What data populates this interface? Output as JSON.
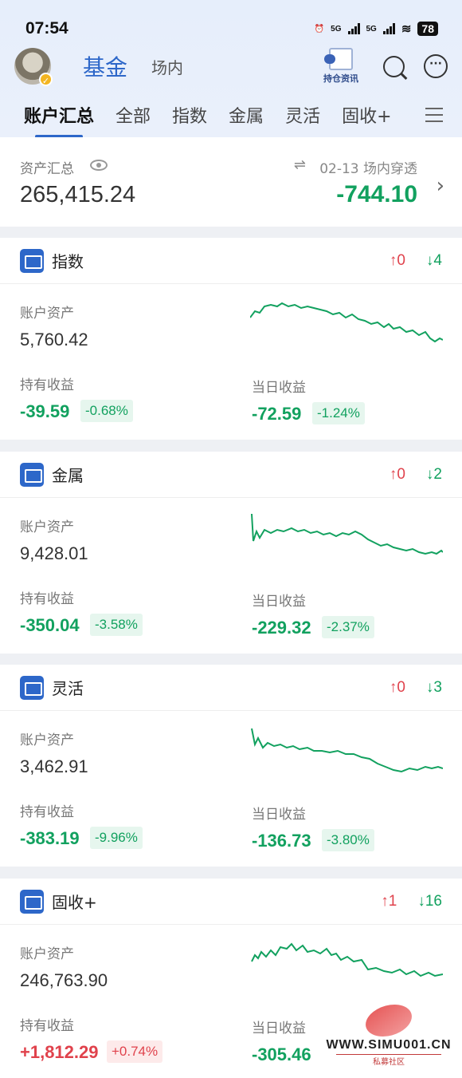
{
  "status_bar": {
    "time": "07:54",
    "net1": "5G",
    "net2": "5G",
    "battery": "78"
  },
  "header": {
    "title": "基金",
    "subtitle": "场内",
    "hold_news": "持仓资讯"
  },
  "tabs": [
    "账户汇总",
    "全部",
    "指数",
    "金属",
    "灵活",
    "固收+"
  ],
  "summary": {
    "label": "资产汇总",
    "value": "265,415.24",
    "date_label": "02-13 场内穿透",
    "change": "-744.10"
  },
  "labels": {
    "assets": "账户资产",
    "holding_pnl": "持有收益",
    "daily_pnl": "当日收益"
  },
  "cards": [
    {
      "title": "指数",
      "up": "↑0",
      "down": "↓4",
      "assets": "5,760.42",
      "holding_pnl": "-39.59",
      "holding_pct": "-0.68%",
      "daily_pnl": "-72.59",
      "daily_pct": "-1.24%"
    },
    {
      "title": "金属",
      "up": "↑0",
      "down": "↓2",
      "assets": "9,428.01",
      "holding_pnl": "-350.04",
      "holding_pct": "-3.58%",
      "daily_pnl": "-229.32",
      "daily_pct": "-2.37%"
    },
    {
      "title": "灵活",
      "up": "↑0",
      "down": "↓3",
      "assets": "3,462.91",
      "holding_pnl": "-383.19",
      "holding_pct": "-9.96%",
      "daily_pnl": "-136.73",
      "daily_pct": "-3.80%"
    },
    {
      "title": "固收+",
      "up": "↑1",
      "down": "↓16",
      "assets": "246,763.90",
      "holding_pnl": "+1,812.29",
      "holding_pct": "+0.74%",
      "daily_pnl": "-305.46",
      "daily_pct": ""
    }
  ],
  "watermark": {
    "url": "WWW.SIMU001.CN",
    "sub": "私募社区"
  },
  "colors": {
    "accent": "#2d67c9",
    "up": "#e0424c",
    "down": "#12a15f"
  }
}
